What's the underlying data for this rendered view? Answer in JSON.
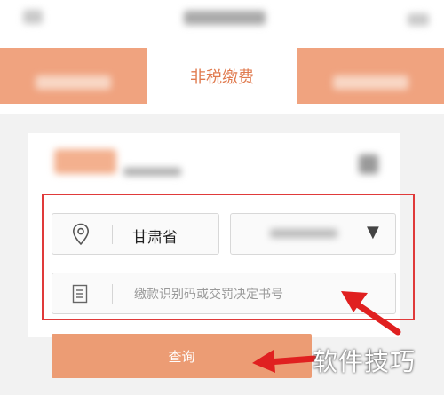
{
  "tabs": {
    "active_label": "非税缴费"
  },
  "form": {
    "province_value": "甘肃省",
    "code_placeholder": "缴款识别码或交罚决定书号",
    "caret_glyph": "▼"
  },
  "actions": {
    "query_label": "查询"
  },
  "watermark": "软件技巧",
  "colors": {
    "accent": "#ec9c74",
    "tab_active_text": "#e07a4e",
    "highlight_border": "#e03a3a"
  }
}
